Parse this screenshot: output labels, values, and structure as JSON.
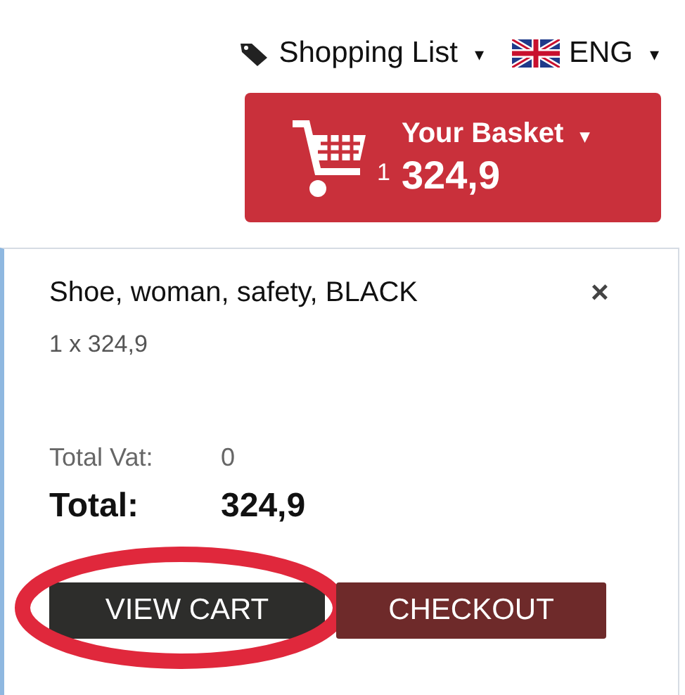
{
  "top_nav": [
    {
      "kind": "tag",
      "label": "Shopping List",
      "caret": "▾"
    },
    {
      "kind": "flag",
      "label": "ENG",
      "caret": "▾"
    }
  ],
  "basket": {
    "title": "Your Basket",
    "caret": "▾",
    "count": "1",
    "amount": "324,9"
  },
  "cart_items": [
    {
      "name": "Shoe, woman, safety, BLACK",
      "remove": "×",
      "quantity": "1 x 324,9"
    }
  ],
  "totals": {
    "vat_label": "Total Vat:",
    "vat": "0",
    "total_label": "Total:",
    "total": "324,9"
  },
  "buttons": [
    {
      "kind": "dark",
      "label": "VIEW CART",
      "highlighted": true
    },
    {
      "kind": "maroon",
      "label": "CHECKOUT",
      "highlighted": false
    }
  ]
}
